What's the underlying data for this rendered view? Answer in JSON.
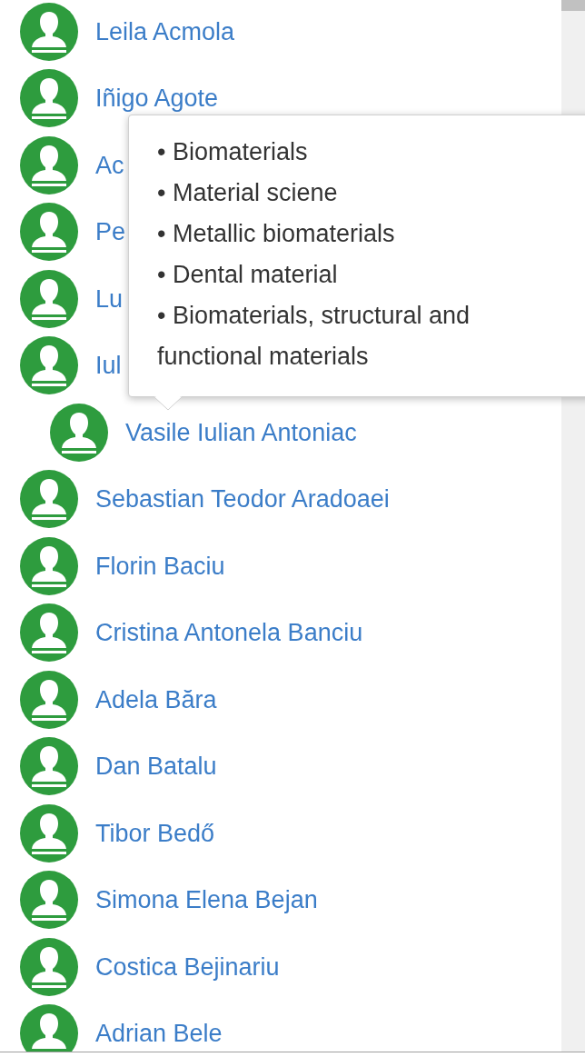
{
  "people": [
    {
      "name": "Leila Acmola"
    },
    {
      "name": "Iñigo Agote"
    },
    {
      "name": "Ac"
    },
    {
      "name": "Pe"
    },
    {
      "name": "Lu"
    },
    {
      "name": "Iul",
      "children": [
        {
          "name": "Vasile Iulian Antoniac"
        }
      ]
    },
    {
      "name": "Sebastian Teodor Aradoaei"
    },
    {
      "name": "Florin Baciu"
    },
    {
      "name": "Cristina Antonela Banciu"
    },
    {
      "name": "Adela Băra"
    },
    {
      "name": "Dan Batalu"
    },
    {
      "name": "Tibor Bedő"
    },
    {
      "name": "Simona Elena Bejan"
    },
    {
      "name": "Costica Bejinariu"
    },
    {
      "name": "Adrian Bele"
    }
  ],
  "tooltip": {
    "items": [
      "• Biomaterials",
      "• Material sciene",
      "• Metallic biomaterials",
      "• Dental material",
      "• Biomaterials, structural and functional materials"
    ]
  }
}
